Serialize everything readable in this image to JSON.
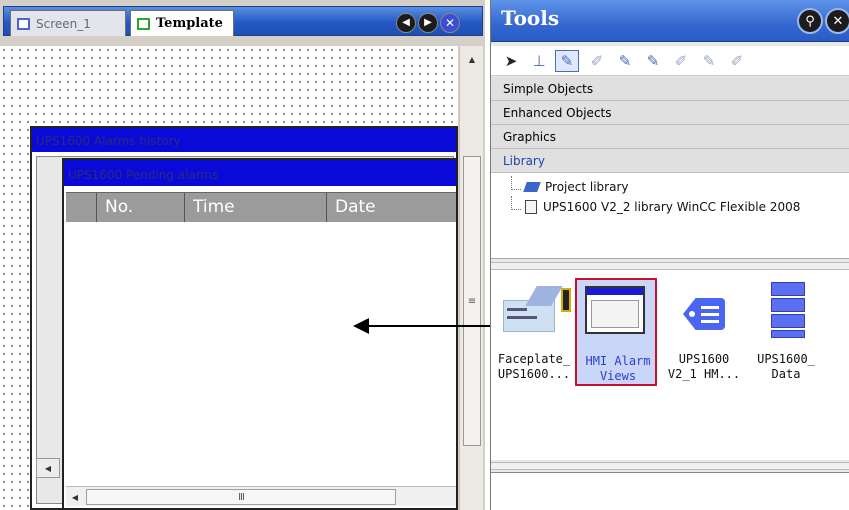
{
  "editor": {
    "tabs": [
      {
        "label": "Screen_1",
        "active": false
      },
      {
        "label": "Template",
        "active": true
      }
    ],
    "alarms_history_title": "UPS1600 Alarms history",
    "pending_alarms_title": "UPS1600 Pending alarms",
    "columns": [
      "No.",
      "Time",
      "Date"
    ]
  },
  "tools": {
    "title": "Tools",
    "sections": [
      "Simple Objects",
      "Enhanced Objects",
      "Graphics",
      "Library"
    ],
    "library_tree": [
      "Project library",
      "UPS1600 V2_2 library WinCC Flexible 2008"
    ],
    "elements": [
      {
        "label_line1": "Faceplate_",
        "label_line2": "UPS1600..."
      },
      {
        "label_line1": "HMI Alarm",
        "label_line2": "Views"
      },
      {
        "label_line1": "UPS1600",
        "label_line2": "V2_1 HM..."
      },
      {
        "label_line1": "UPS1600_",
        "label_line2": "Data"
      }
    ]
  },
  "colors": {
    "header_blue": "#2a5cc4",
    "alarm_title_blue": "#0a0ad8",
    "selection_red": "#c8102e"
  }
}
